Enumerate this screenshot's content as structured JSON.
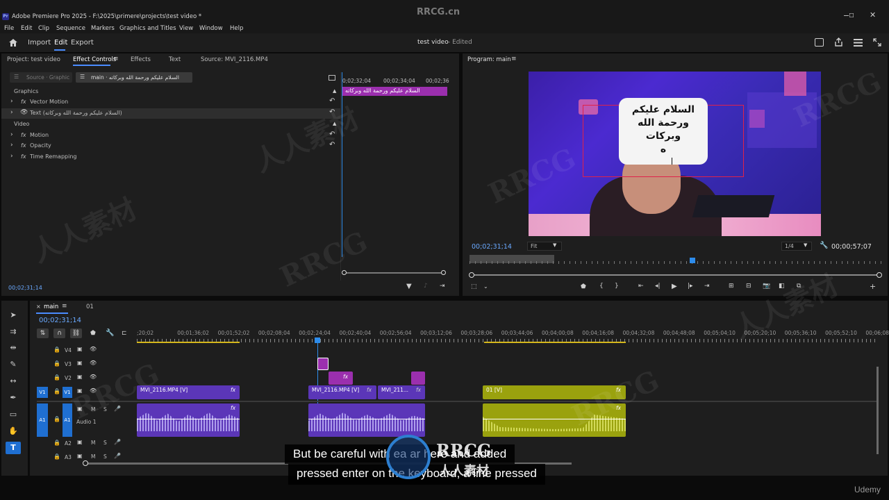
{
  "window": {
    "title": "Adobe Premiere Pro 2025 - F:\\2025\\primere\\projects\\test video *",
    "app_badge": "Pr",
    "watermark_top": "RRCG.cn"
  },
  "menu": [
    "File",
    "Edit",
    "Clip",
    "Sequence",
    "Markers",
    "Graphics and Titles",
    "View",
    "Window",
    "Help"
  ],
  "header": {
    "tabs": [
      "Import",
      "Edit",
      "Export"
    ],
    "active_tab": "Edit",
    "project_title": "test video",
    "status": "- Edited"
  },
  "source_panel": {
    "tabs": [
      "Project: test video",
      "Effect Controls",
      "Effects",
      "Text",
      "Source: MVI_2116.MP4"
    ],
    "active_tab": "Effect Controls",
    "source_selector": "Source · Graphic",
    "clip_selector": "main · السلام عليكم ورحمة الله وبركاته",
    "timecodes": [
      "0;02;32;04",
      "00;02;34;04",
      "00;02;36"
    ],
    "clip_bar_label": "السلام عليكم ورحمة الله وبركاته",
    "groups": [
      {
        "name": "Graphics",
        "items": [
          {
            "label": "Vector Motion",
            "type": "fx"
          },
          {
            "label": "Text (السلام عليكم ورحمة الله وبركاته)",
            "type": "eye"
          }
        ]
      },
      {
        "name": "Video",
        "items": [
          {
            "label": "Motion",
            "type": "fx"
          },
          {
            "label": "Opacity",
            "type": "fx"
          },
          {
            "label": "Time Remapping",
            "type": "fx"
          }
        ]
      }
    ],
    "current_time": "00;02;31;14"
  },
  "program_monitor": {
    "title": "Program: main",
    "overlay_text": [
      "السلام عليكم",
      "ورحمة الله",
      "وبركات",
      "ه"
    ],
    "current_time": "00;02;31;14",
    "fit": "Fit",
    "resolution": "1/4",
    "duration": "00;00;57;07",
    "playhead_fraction": 0.54
  },
  "timeline": {
    "tabs": [
      "main",
      "01"
    ],
    "active_tab": "main",
    "current_time": "00;02;31;14",
    "ruler": [
      ";20;02",
      "00;01;36;02",
      "00;01;52;02",
      "00;02;08;04",
      "00;02;24;04",
      "00;02;40;04",
      "00;02;56;04",
      "00;03;12;06",
      "00;03;28;06",
      "00;03;44;06",
      "00;04;00;08",
      "00;04;16;08",
      "00;04;32;08",
      "00;04;48;08",
      "00;05;04;10",
      "00;05;20;10",
      "00;05;36;10",
      "00;05;52;10",
      "00;06;08;"
    ],
    "video_tracks": [
      "V4",
      "V3",
      "V2",
      "V1"
    ],
    "audio_tracks": [
      "A1",
      "A2",
      "A3"
    ],
    "audio1_name": "Audio 1",
    "clips": {
      "v1_a": "MVI_2116.MP4 [V]",
      "v1_b": "MVI_2116.MP4 [V]",
      "v1_c": "MVI_211...",
      "v1_d": "01 [V]",
      "fx": "fx"
    }
  },
  "captions": [
    "But be careful with  ea    ar  here and added",
    "pressed enter on the keyboard,   a line pressed"
  ],
  "brand": "Udemy",
  "watermarks": [
    "人人素材",
    "RRCG",
    "RRCG",
    "人人素材",
    "RRCG",
    "人人素材",
    "RRCG",
    "RRCG"
  ],
  "center_logo": {
    "line1": "RRCG",
    "line2": "人人素材"
  },
  "colors": {
    "accent": "#2d8ceb",
    "clip_purple": "#5b36b8",
    "clip_magenta": "#9b2fae",
    "clip_yellow": "#9aa20e",
    "track_blue": "#1f6fd1"
  }
}
